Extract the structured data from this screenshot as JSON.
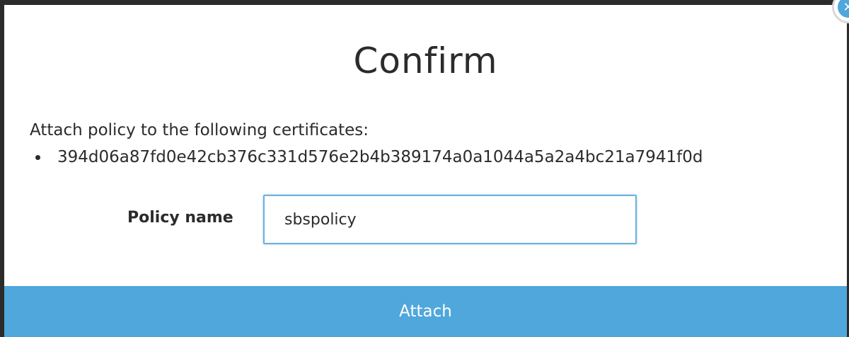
{
  "dialog": {
    "title": "Confirm",
    "intro": "Attach policy to the following certificates:",
    "certificates": [
      "394d06a87fd0e42cb376c331d576e2b4b389174a0a1044a5a2a4bc21a7941f0d"
    ],
    "policy_field": {
      "label": "Policy name",
      "value": "sbspolicy",
      "placeholder": ""
    },
    "primary_button": "Attach",
    "close_icon": "close-icon"
  },
  "colors": {
    "accent": "#4fa7dc",
    "input_focus_border": "#6cb0e0",
    "text": "#2b2b2b",
    "backdrop": "#2b2b2b"
  }
}
